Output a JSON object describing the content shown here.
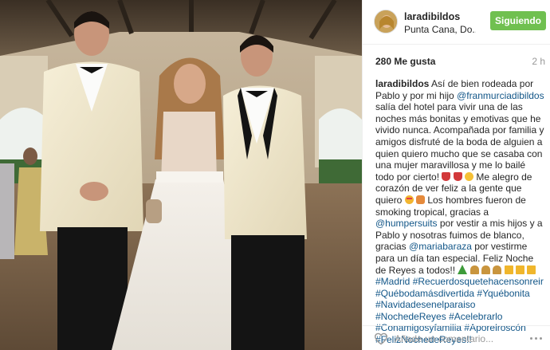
{
  "post": {
    "username": "laradibildos",
    "location": "Punta Cana, Do...",
    "follow_label": "Siguiendo",
    "likes": "280 Me gusta",
    "time_ago": "2 h",
    "caption": {
      "username": "laradibildos",
      "t1": " Así de bien rodeada por Pablo y por mi hijo ",
      "mention1": "@franmurciadibildos",
      "t2": " salía del hotel para vivir una de las noches más bonitas y emotivas que he vivido nunca. Acompañada por familia y amigos disfruté de la boda de alguien a quien quiero mucho que se casaba con una mujer maravillosa y me lo bailé todo por cierto! ",
      "t3": " Me alegro de corazón de ver feliz a la gente que quiero ",
      "t4": " Los hombres fueron de smoking tropical, gracias a ",
      "mention2": "@humpersuits",
      "t5": " por vestir a mis hijos y a Pablo y nosotras fuimos de blanco, gracias ",
      "mention3": "@mariabaraza",
      "t6": " por vestirme para un día tan especial. Feliz Noche de Reyes a todos!! ",
      "hashtags": [
        "#Madrid",
        "#Recuerdosquetehacensonreir",
        "#Québodamásdivertida",
        "#Yquébonita",
        "#Navidadesenelparaiso",
        "#NochedeReyes",
        "#Acelebrarlo",
        "#Conamigosyfamilia",
        "#Aporelroscón",
        "#FelizNochedeReyes!!"
      ]
    },
    "comment_placeholder": "Añade un comentario...",
    "icons": {
      "like": "heart-outline-icon",
      "more": "more-options-icon"
    }
  },
  "colors": {
    "follow_button": "#70c050",
    "link": "#125688",
    "muted": "#999999"
  }
}
